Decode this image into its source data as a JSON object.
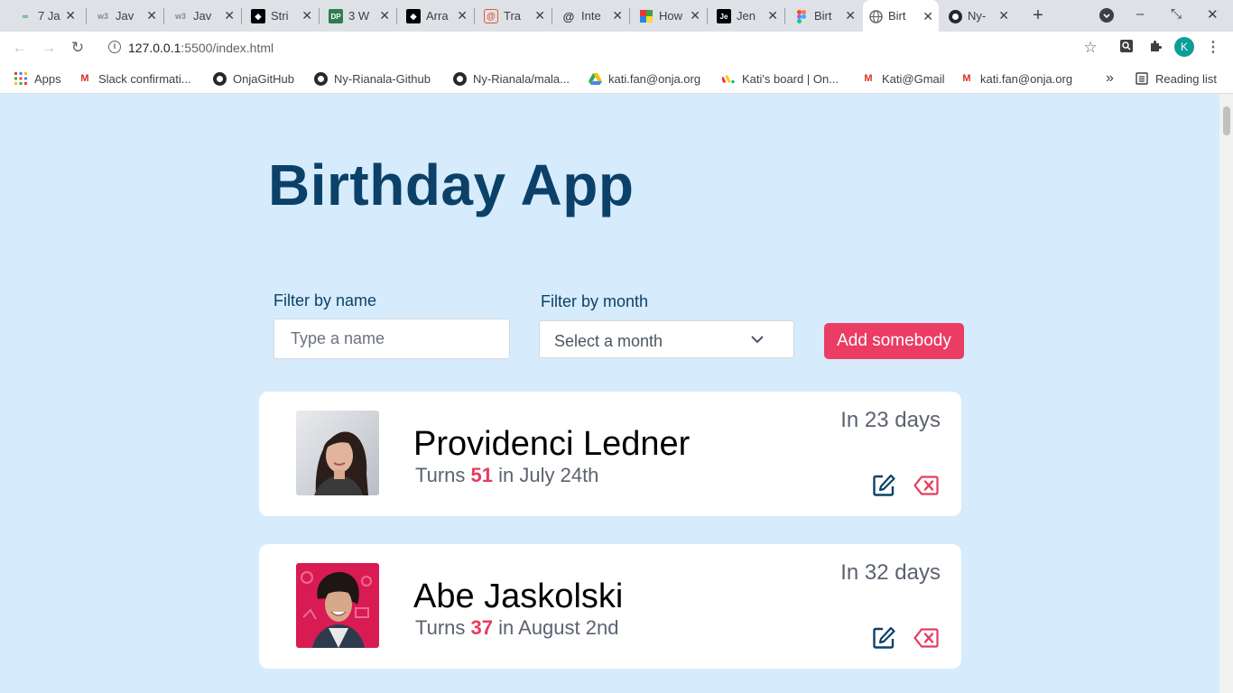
{
  "browser": {
    "tabs": [
      {
        "label": "7 Ja",
        "icon": "infinity-icon"
      },
      {
        "label": "Jav",
        "icon": "w3schools-icon"
      },
      {
        "label": "Jav",
        "icon": "w3schools-icon"
      },
      {
        "label": "Stri",
        "icon": "codepen-icon"
      },
      {
        "label": "3 W",
        "icon": "dp-icon"
      },
      {
        "label": "Arra",
        "icon": "codepen-icon"
      },
      {
        "label": "Tra",
        "icon": "spiral-icon"
      },
      {
        "label": "Inte",
        "icon": "swirl-icon"
      },
      {
        "label": "How",
        "icon": "grid-icon"
      },
      {
        "label": "Jen",
        "icon": "je-icon"
      },
      {
        "label": "Birt",
        "icon": "figma-icon"
      },
      {
        "label": "Birt",
        "icon": "globe-icon",
        "active": true
      },
      {
        "label": "Ny-",
        "icon": "github-icon"
      }
    ],
    "url": {
      "host": "127.0.0.1",
      "rest": ":5500/index.html"
    },
    "profile_initial": "K",
    "bookmarks": [
      {
        "label": "Apps",
        "icon": "apps-grid-icon"
      },
      {
        "label": "Slack confirmati...",
        "icon": "gmail-icon"
      },
      {
        "label": "OnjaGitHub",
        "icon": "github-icon"
      },
      {
        "label": "Ny-Rianala-Github",
        "icon": "github-icon"
      },
      {
        "label": "Ny-Rianala/mala...",
        "icon": "github-icon"
      },
      {
        "label": "kati.fan@onja.org",
        "icon": "drive-icon"
      },
      {
        "label": "Kati's board | On...",
        "icon": "monday-icon"
      },
      {
        "label": "Kati@Gmail",
        "icon": "gmail-icon"
      },
      {
        "label": "kati.fan@onja.org",
        "icon": "gmail-icon"
      }
    ],
    "reading_list": "Reading list",
    "more_bookmarks": "»"
  },
  "app": {
    "title": "Birthday App",
    "filter_name_label": "Filter by name",
    "filter_name_placeholder": "Type a name",
    "filter_month_label": "Filter by month",
    "filter_month_value": "Select a month",
    "add_button": "Add somebody",
    "accent_color": "#eb3c64",
    "title_color": "#0b4168",
    "people": [
      {
        "name": "Providenci Ledner",
        "turns_prefix": "Turns ",
        "age": "51",
        "turns_suffix": " in July 24th",
        "days": "In 23 days"
      },
      {
        "name": "Abe Jaskolski",
        "turns_prefix": "Turns ",
        "age": "37",
        "turns_suffix": " in August 2nd",
        "days": "In 32 days"
      }
    ]
  }
}
